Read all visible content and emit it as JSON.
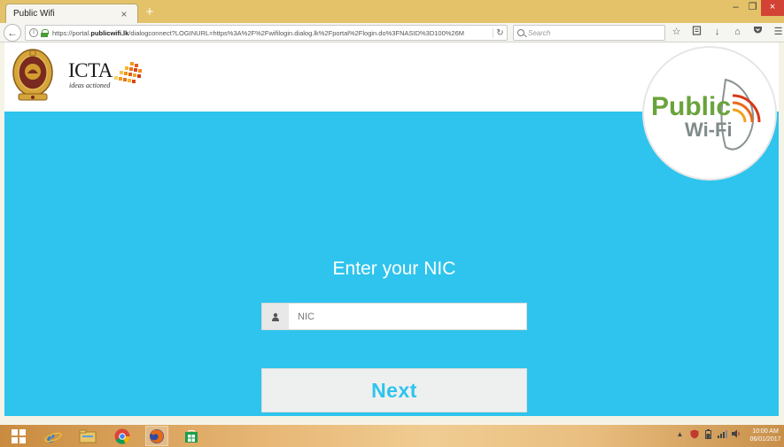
{
  "browser": {
    "tab_title": "Public Wifi",
    "tab_close": "×",
    "new_tab": "+",
    "url_prefix": "https://portal.",
    "url_domain": "publicwifi.lk",
    "url_rest": "/dialogconnect?LOGINURL=https%3A%2F%2Fwifilogin.dialog.lk%2Fportal%2Flogin.do%3FNASID%3D100%26M",
    "search_placeholder": "Search",
    "win_minimize": "–",
    "win_restore": "❐",
    "win_close": "×"
  },
  "header": {
    "icta_name": "ICTA",
    "icta_tagline": "ideas actioned",
    "badge_line1": "Public",
    "badge_line2": "Wi-Fi"
  },
  "form": {
    "title": "Enter your NIC",
    "nic_placeholder": "NIC",
    "next_label": "Next"
  },
  "taskbar": {
    "time": "10:00 AM",
    "date": "06/01/2017"
  },
  "colors": {
    "accent": "#2ec4ed",
    "button_bg": "#eef0f0",
    "badge_green": "#6aa33c",
    "badge_gray": "#7f8b8a"
  }
}
